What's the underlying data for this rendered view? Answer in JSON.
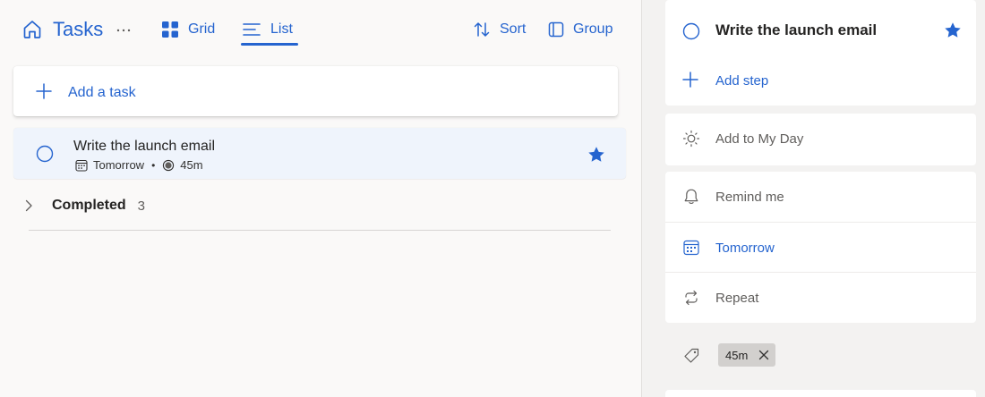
{
  "header": {
    "title": "Tasks",
    "views": {
      "grid_label": "Grid",
      "list_label": "List"
    },
    "sort_label": "Sort",
    "group_label": "Group"
  },
  "add_task": {
    "label": "Add a task"
  },
  "tasks": [
    {
      "title": "Write the launch email",
      "due": "Tomorrow",
      "duration": "45m",
      "important": true
    }
  ],
  "completed": {
    "label": "Completed",
    "count": "3"
  },
  "details": {
    "title": "Write the launch email",
    "add_step": "Add step",
    "add_to_my_day": "Add to My Day",
    "remind_me": "Remind me",
    "due_date": "Tomorrow",
    "repeat": "Repeat",
    "categories": {
      "chips": [
        "45m"
      ],
      "input_value": ""
    }
  },
  "colors": {
    "accent": "#2564cf",
    "pane_bg": "#f3f2f1",
    "task_selected_bg": "#eff4fc"
  }
}
